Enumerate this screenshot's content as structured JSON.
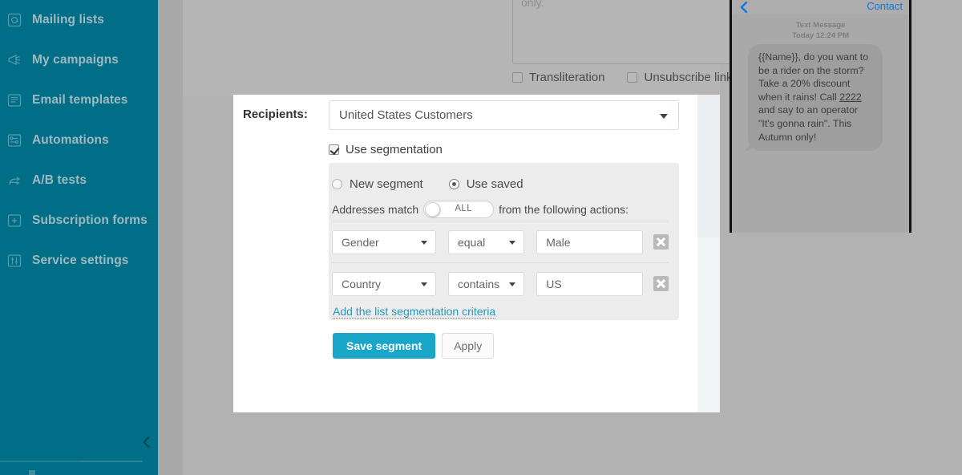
{
  "sidebar": {
    "brand_color": "#006e87",
    "items": [
      {
        "label": "Mailing lists",
        "icon": "at-list-icon"
      },
      {
        "label": "My campaigns",
        "icon": "megaphone-icon"
      },
      {
        "label": "Email templates",
        "icon": "template-icon"
      },
      {
        "label": "Automations",
        "icon": "automation-flow-icon"
      },
      {
        "label": "A/B tests",
        "icon": "ab-split-icon"
      },
      {
        "label": "Subscription forms",
        "icon": "form-plus-icon"
      },
      {
        "label": "Service settings",
        "icon": "sliders-icon"
      }
    ],
    "collapse_icon": "chevron-left-icon"
  },
  "underlying_form": {
    "textarea_value": "only.",
    "transliteration": {
      "label": "Transliteration",
      "checked": false
    },
    "unsubscribe_link": {
      "label": "Unsubscribe link",
      "checked": false
    },
    "help_icon": "question-circle-icon"
  },
  "card": {
    "recipients_label": "Recipients:",
    "list_select": {
      "value": "United States Customers",
      "caret_icon": "chevron-down-icon"
    },
    "use_segmentation": {
      "label": "Use segmentation",
      "checked": true
    },
    "segmentation": {
      "mode_options": [
        {
          "label": "New segment",
          "selected": false
        },
        {
          "label": "Use saved",
          "selected": true
        }
      ],
      "match_prefix": "Addresses match",
      "match_toggle_value": "ALL",
      "match_suffix": "from the following actions:",
      "criteria": [
        {
          "field": "Gender",
          "operator": "equal",
          "value": "Male",
          "delete_icon": "close-x-icon"
        },
        {
          "field": "Country",
          "operator": "contains",
          "value": "US",
          "delete_icon": "close-x-icon"
        }
      ],
      "add_criteria_link": "Add the list segmentation criteria",
      "save_button": "Save segment",
      "apply_button": "Apply",
      "primary_color": "#19a6c8",
      "link_color": "#2797b4"
    }
  },
  "phone_preview": {
    "back_icon": "chevron-left-icon",
    "contact_label": "Contact",
    "contact_color": "#1177d9",
    "message_kind": "Text Message",
    "message_time": "Today 12:24 PM",
    "message_body_pre": "{{Name}}, do you want to be a rider on the storm? Take a 20% discount when it rains! Call ",
    "message_body_link": "2222",
    "message_body_post": " and say to an operator \"It's gonna rain\". This Autumn only!"
  }
}
